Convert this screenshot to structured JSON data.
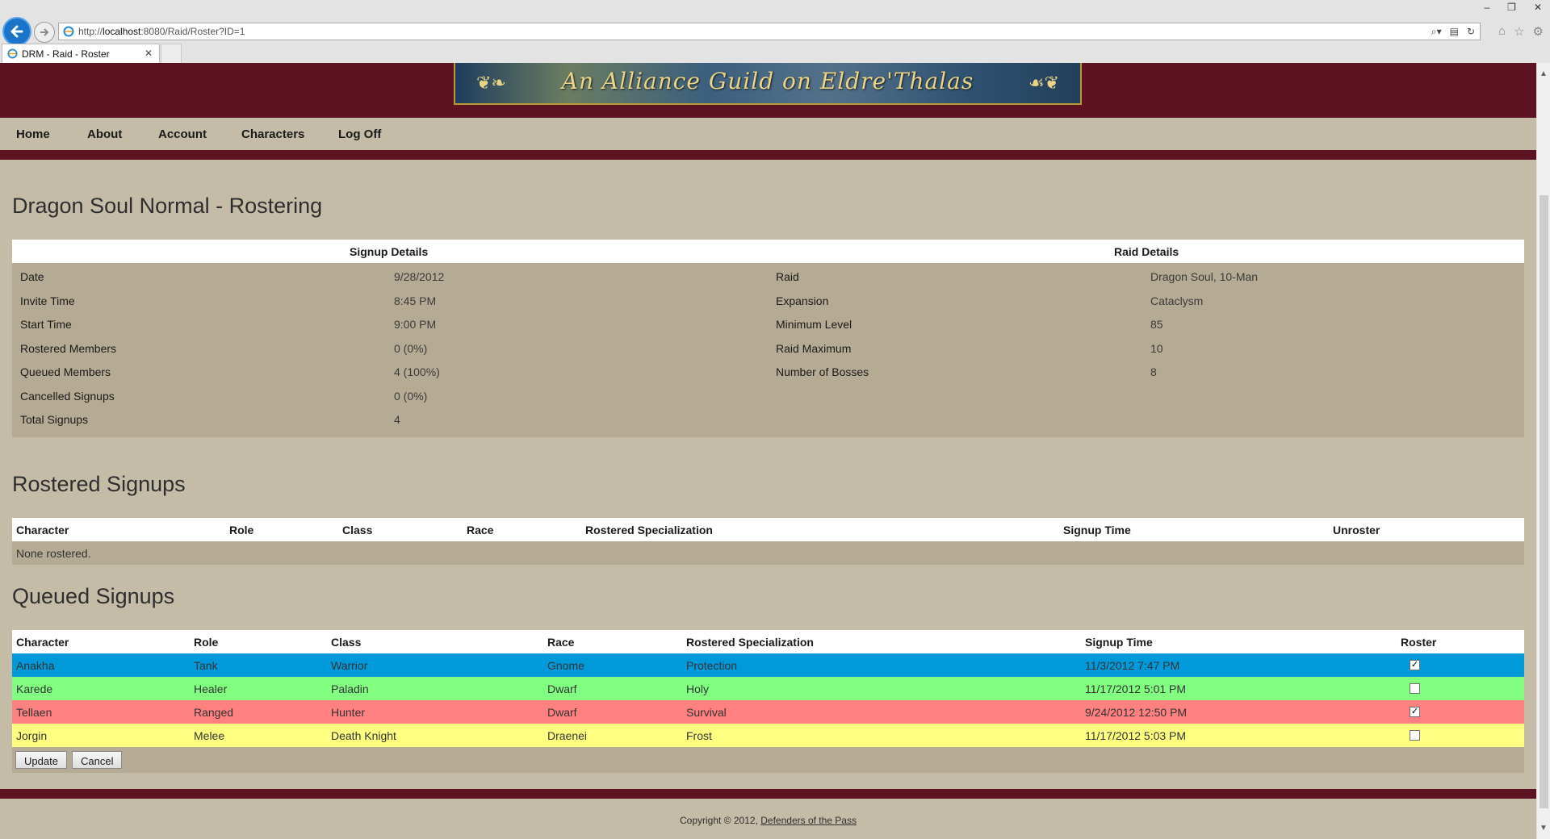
{
  "browser": {
    "url_prefix": "http://",
    "url_host": "localhost",
    "url_rest": ":8080/Raid/Roster?ID=1",
    "tab_title": "DRM - Raid - Roster"
  },
  "banner": {
    "text": "An Alliance Guild on Eldre'Thalas"
  },
  "nav": {
    "home": "Home",
    "about": "About",
    "account": "Account",
    "characters": "Characters",
    "logoff": "Log Off"
  },
  "page": {
    "title": "Dragon Soul Normal - Rostering"
  },
  "details": {
    "signup_header": "Signup Details",
    "raid_header": "Raid Details",
    "signup": [
      {
        "label": "Date",
        "value": "9/28/2012"
      },
      {
        "label": "Invite Time",
        "value": "8:45 PM"
      },
      {
        "label": "Start Time",
        "value": "9:00 PM"
      },
      {
        "label": "Rostered Members",
        "value": "0 (0%)"
      },
      {
        "label": "Queued Members",
        "value": "4 (100%)"
      },
      {
        "label": "Cancelled Signups",
        "value": "0 (0%)"
      },
      {
        "label": "Total Signups",
        "value": "4"
      }
    ],
    "raid": [
      {
        "label": "Raid",
        "value": "Dragon Soul, 10-Man"
      },
      {
        "label": "Expansion",
        "value": "Cataclysm"
      },
      {
        "label": "Minimum Level",
        "value": "85"
      },
      {
        "label": "Raid Maximum",
        "value": "10"
      },
      {
        "label": "Number of Bosses",
        "value": "8"
      }
    ]
  },
  "rostered": {
    "title": "Rostered Signups",
    "headers": [
      "Character",
      "Role",
      "Class",
      "Race",
      "Rostered Specialization",
      "Signup Time",
      "Unroster"
    ],
    "empty": "None rostered."
  },
  "queued": {
    "title": "Queued Signups",
    "headers": [
      "Character",
      "Role",
      "Class",
      "Race",
      "Rostered Specialization",
      "Signup Time",
      "Roster"
    ],
    "rows": [
      {
        "character": "Anakha",
        "role": "Tank",
        "class": "Warrior",
        "race": "Gnome",
        "spec": "Protection",
        "time": "11/3/2012 7:47 PM",
        "checked": true,
        "color": "#0099d9"
      },
      {
        "character": "Karede",
        "role": "Healer",
        "class": "Paladin",
        "race": "Dwarf",
        "spec": "Holy",
        "time": "11/17/2012 5:01 PM",
        "checked": false,
        "color": "#80ff80"
      },
      {
        "character": "Tellaen",
        "role": "Ranged",
        "class": "Hunter",
        "race": "Dwarf",
        "spec": "Survival",
        "time": "9/24/2012 12:50 PM",
        "checked": true,
        "color": "#ff8080"
      },
      {
        "character": "Jorgin",
        "role": "Melee",
        "class": "Death Knight",
        "race": "Draenei",
        "spec": "Frost",
        "time": "11/17/2012 5:03 PM",
        "checked": false,
        "color": "#ffff80"
      }
    ],
    "update_label": "Update",
    "cancel_label": "Cancel"
  },
  "footer": {
    "copyright": "Copyright © 2012,",
    "link": "Defenders of the Pass"
  }
}
